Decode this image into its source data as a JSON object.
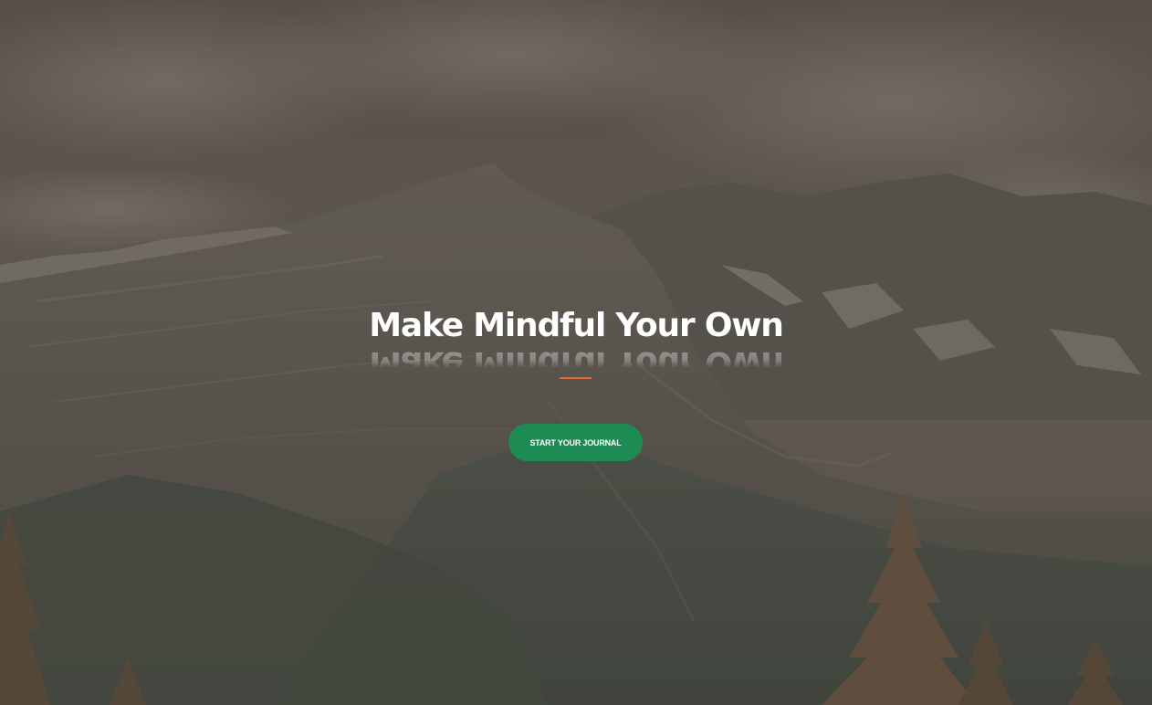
{
  "hero": {
    "title": "Make Mindful Your Own",
    "cta_label": "START YOUR JOURNAL",
    "background_description_icon": "mountain-landscape-image"
  },
  "colors": {
    "accent_divider": "#e8653a",
    "cta_background": "#1e8a54",
    "title_text": "#ffffff",
    "overlay": "#5a5650"
  }
}
